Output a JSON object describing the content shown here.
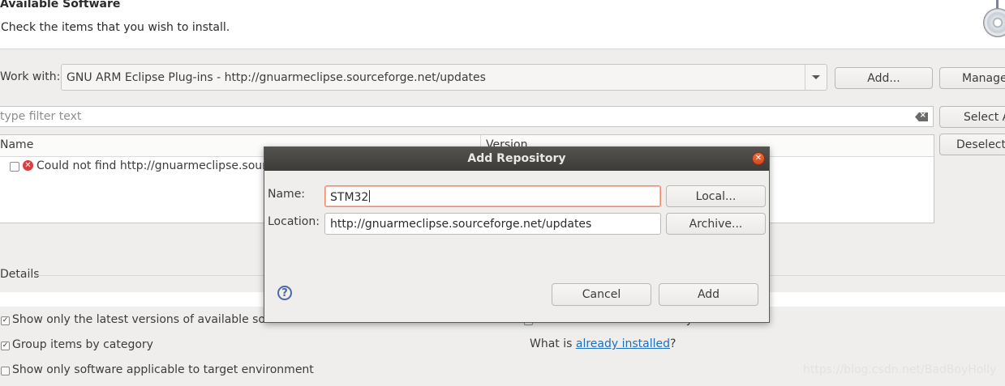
{
  "header": {
    "title": "Available Software",
    "subtitle": "Check the items that you wish to install.",
    "icon": "cd-install-icon"
  },
  "work_with": {
    "label": "Work with:",
    "value": "GNU ARM Eclipse Plug-ins - http://gnuarmeclipse.sourceforge.net/updates",
    "add_label": "Add...",
    "manage_label": "Manage"
  },
  "filter": {
    "placeholder": "type filter text",
    "select_all_label": "Select A",
    "deselect_label": "Deselect"
  },
  "table": {
    "columns": [
      "Name",
      "Version"
    ],
    "rows": [
      {
        "name": "Could not find http://gnuarmeclipse.sourc",
        "status_icon": "error-icon"
      }
    ]
  },
  "details": {
    "label": "Details"
  },
  "options": {
    "latest_versions": {
      "label": "Show only the latest versions of available software",
      "checked": true
    },
    "group_by_category": {
      "label": "Group items by category",
      "checked": true
    },
    "target_env": {
      "label": "Show only software applicable to target environment",
      "checked": false
    },
    "hide_installed": {
      "label": "Hide items that are already installed",
      "checked": false
    },
    "what_is_prefix": "What is ",
    "already_installed_link": "already installed",
    "what_is_suffix": "?"
  },
  "dialog": {
    "title": "Add Repository",
    "name_label": "Name:",
    "name_value": "STM32",
    "location_label": "Location:",
    "location_value": "http://gnuarmeclipse.sourceforge.net/updates",
    "local_label": "Local...",
    "archive_label": "Archive...",
    "cancel_label": "Cancel",
    "add_label": "Add",
    "help_icon": "help-icon",
    "close_icon": "close-icon"
  },
  "watermark": "https://blog.csdn.net/BadBoyHolly",
  "colors": {
    "window_bg": "#efeeec",
    "dialog_title_bg": "#3d3b38",
    "close_button": "#e0552a",
    "link": "#1f6fbf",
    "focus_border": "#f08a6c",
    "error": "#d64040"
  }
}
